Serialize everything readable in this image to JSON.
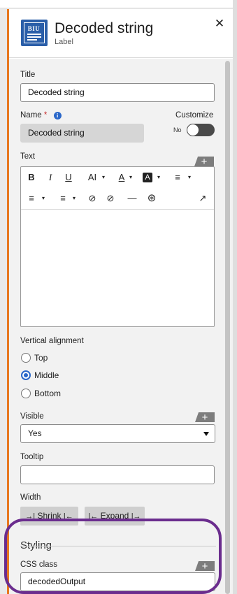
{
  "header": {
    "title": "Decoded string",
    "subtitle": "Label",
    "icon_text": "BIU",
    "close": "✕"
  },
  "fields": {
    "title_label": "Title",
    "title_value": "Decoded string",
    "name_label": "Name",
    "name_required": "*",
    "name_info": "i",
    "name_value": "Decoded string",
    "customize_label": "Customize",
    "customize_state": "No",
    "text_label": "Text",
    "plus": "+"
  },
  "toolbar": {
    "bold": "B",
    "italic": "I",
    "underline": "U",
    "font_size": "AI",
    "font_color": "A",
    "highlight": "A",
    "numbered_list": "≡",
    "bullet_list": "≡",
    "align": "≡",
    "link": "⊘",
    "unlink": "⊘",
    "horizontal_rule": "—",
    "accessibility": "⊛",
    "popout": "↗",
    "caret": "▾"
  },
  "vertical_alignment": {
    "label": "Vertical alignment",
    "options": [
      "Top",
      "Middle",
      "Bottom"
    ],
    "selected": "Middle"
  },
  "visible": {
    "label": "Visible",
    "value": "Yes"
  },
  "tooltip": {
    "label": "Tooltip",
    "value": ""
  },
  "width": {
    "label": "Width",
    "shrink": "Shrink",
    "expand": "Expand",
    "shrink_icon_left": "→|",
    "shrink_icon_right": "|←",
    "expand_icon_left": "|←",
    "expand_icon_right": "|→"
  },
  "styling": {
    "title": "Styling",
    "css_label": "CSS class",
    "css_value": "decodedOutput"
  },
  "colors": {
    "accent_orange": "#e8771e",
    "brand_blue": "#2a5ea8",
    "highlight_purple": "#6b2d8e",
    "radio_blue": "#2a67c9"
  }
}
